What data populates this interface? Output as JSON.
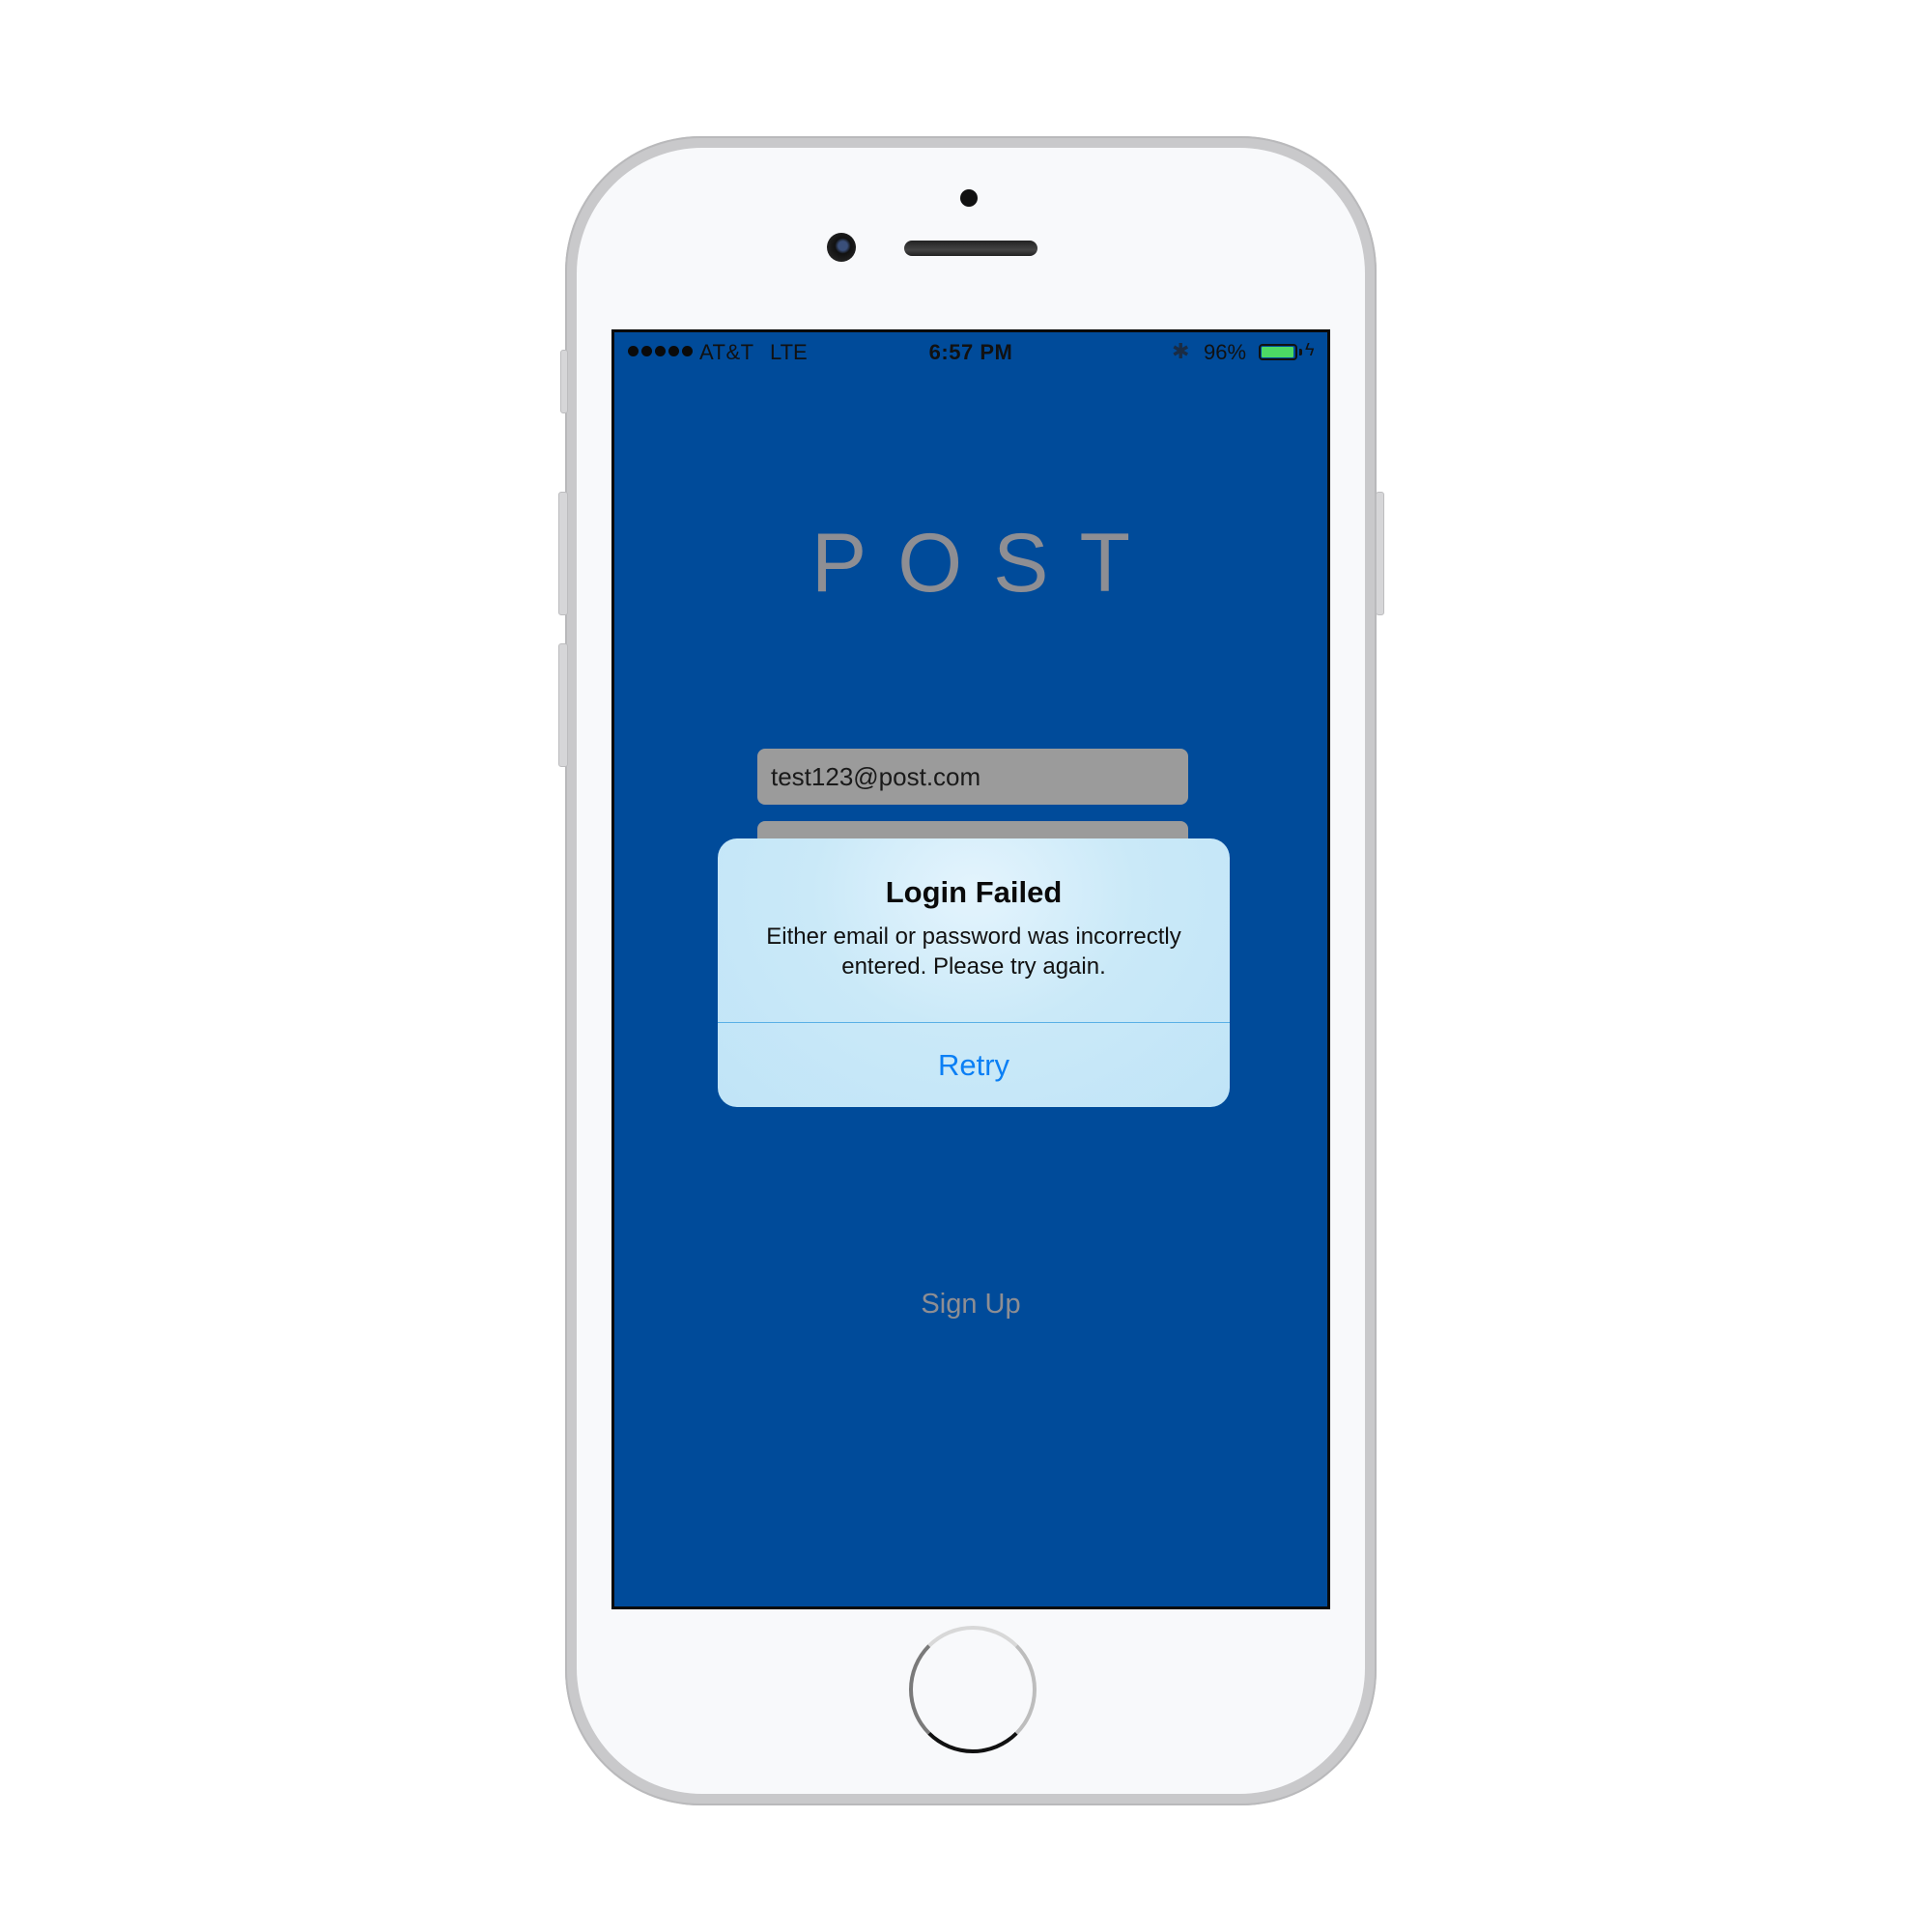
{
  "status_bar": {
    "carrier": "AT&T",
    "network": "LTE",
    "time": "6:57 PM",
    "battery_percent_text": "96%",
    "battery_level": 0.96,
    "battery_color": "#4cd964",
    "icons": [
      "signal-dots-icon",
      "bluetooth-icon",
      "battery-icon",
      "charging-bolt-icon"
    ]
  },
  "app": {
    "logo": "POST",
    "background_color": "#004b9a"
  },
  "login_form": {
    "email_value": "test123@post.com",
    "password_value": ""
  },
  "alert": {
    "title": "Login Failed",
    "message": "Either email or password was incorrectly entered. Please try again.",
    "button_label": "Retry",
    "button_color": "#0a7ff5"
  },
  "sign_up_label": "Sign Up"
}
